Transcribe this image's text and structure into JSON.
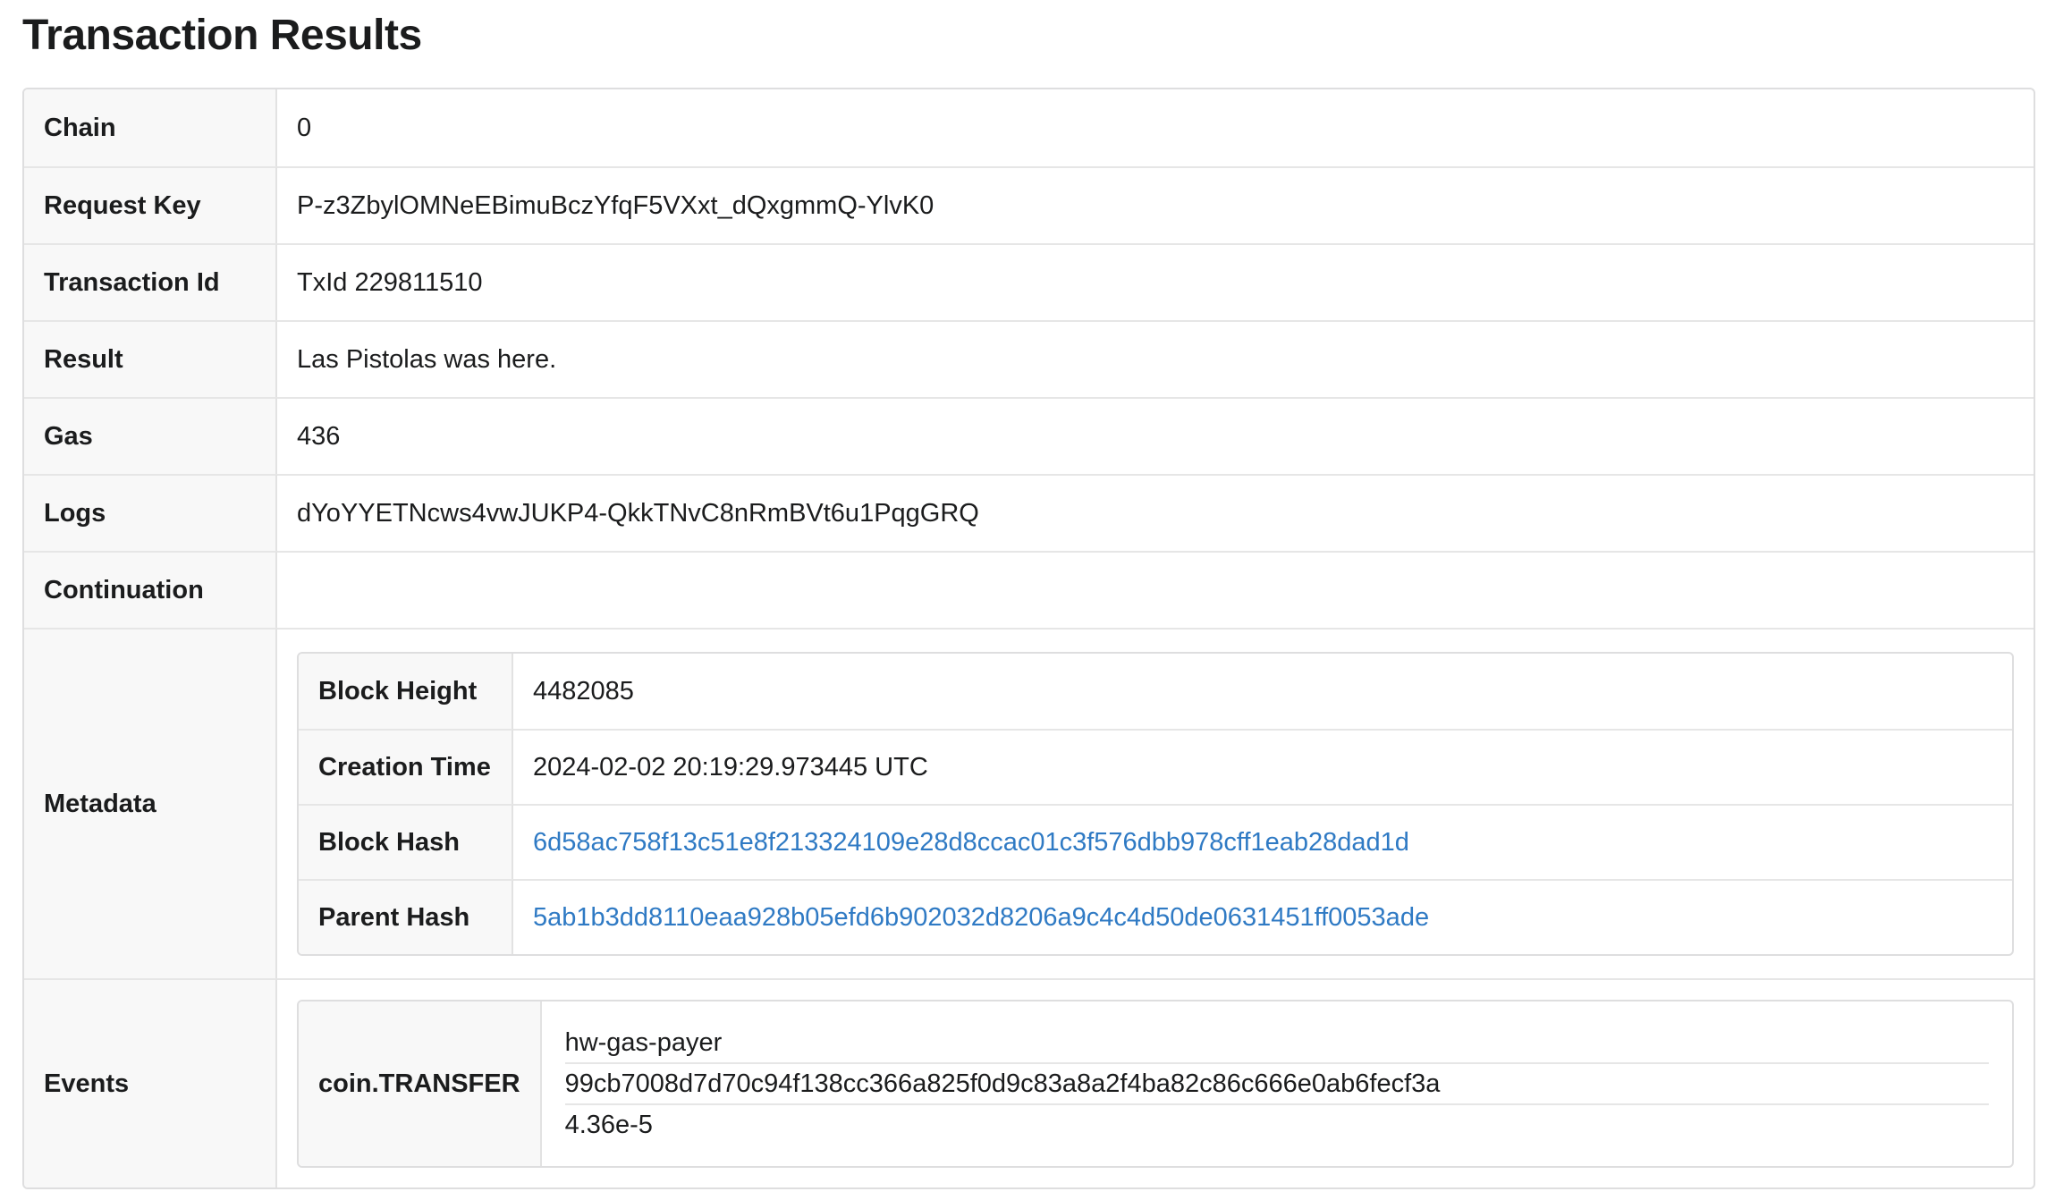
{
  "page": {
    "title": "Transaction Results"
  },
  "rows": {
    "chain": {
      "label": "Chain",
      "value": "0"
    },
    "request_key": {
      "label": "Request Key",
      "value": "P-z3ZbylOMNeEBimuBczYfqF5VXxt_dQxgmmQ-YlvK0"
    },
    "transaction_id": {
      "label": "Transaction Id",
      "value": "TxId 229811510"
    },
    "result": {
      "label": "Result",
      "value": "Las Pistolas was here."
    },
    "gas": {
      "label": "Gas",
      "value": "436"
    },
    "logs": {
      "label": "Logs",
      "value": "dYoYYETNcws4vwJUKP4-QkkTNvC8nRmBVt6u1PqgGRQ"
    },
    "continuation": {
      "label": "Continuation",
      "value": ""
    },
    "metadata": {
      "label": "Metadata",
      "block_height": {
        "label": "Block Height",
        "value": "4482085"
      },
      "creation_time": {
        "label": "Creation Time",
        "value": "2024-02-02 20:19:29.973445 UTC"
      },
      "block_hash": {
        "label": "Block Hash",
        "value": "6d58ac758f13c51e8f213324109e28d8ccac01c3f576dbb978cff1eab28dad1d"
      },
      "parent_hash": {
        "label": "Parent Hash",
        "value": "5ab1b3dd8110eaa928b05efd6b902032d8206a9c4c4d50de0631451ff0053ade"
      }
    },
    "events": {
      "label": "Events",
      "items": [
        {
          "name": "coin.TRANSFER",
          "params": [
            "hw-gas-payer",
            "99cb7008d7d70c94f138cc366a825f0d9c83a8a2f4ba82c86c666e0ab6fecf3a",
            "4.36e-5"
          ]
        }
      ]
    }
  },
  "colors": {
    "link": "#2f7ac4",
    "key_bg": "#f8f8f8",
    "border": "#dededf"
  }
}
